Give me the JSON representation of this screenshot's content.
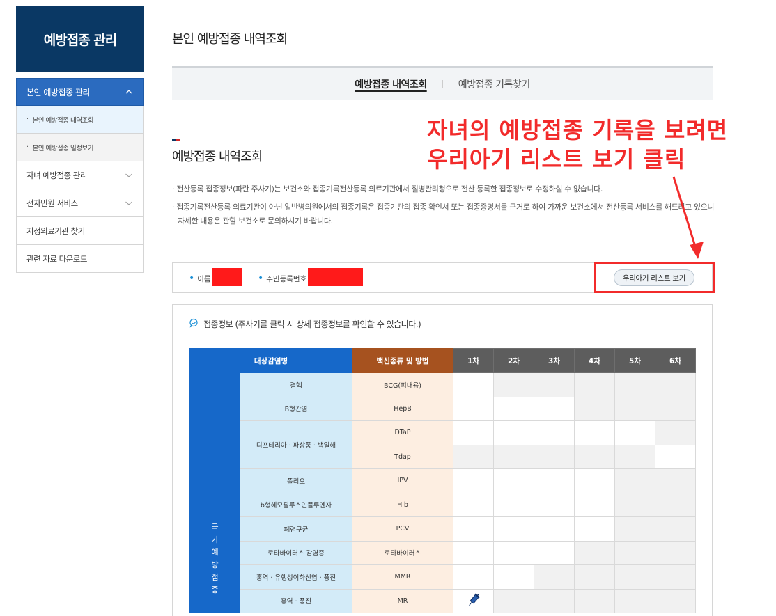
{
  "sidebar": {
    "title": "예방접종 관리",
    "section": "본인 예방접종 관리",
    "sub_items": [
      "본인 예방접종 내역조회",
      "본인 예방접종 일정보기"
    ],
    "items": [
      "자녀 예방접종 관리",
      "전자민원 서비스",
      "지정의료기관 찾기",
      "관련 자료 다운로드"
    ]
  },
  "page": {
    "title": "본인 예방접종 내역조회",
    "tabs": [
      "예방접종 내역조회",
      "예방접종 기록찾기"
    ],
    "section_title": "예방접종 내역조회",
    "notices": [
      "· 전산등록 접종정보(파란 주사기)는 보건소와 접종기록전산등록 의료기관에서 질병관리청으로 전산 등록한 접종정보로 수정하실 수 없습니다.",
      "· 접종기록전산등록 의료기관이 아닌 일반병의원에서의 접종기록은 접종기관의 접종 확인서 또는 접종증명서를 근거로 하여 가까운 보건소에서 전산등록 서비스를 해드리고 있으니 자세한 내용은 관할 보건소로 문의하시기 바랍니다."
    ]
  },
  "annotation": {
    "line1": "자녀의 예방접종 기록을 보려면",
    "line2": "우리아기 리스트 보기 클릭",
    "color": "#f22b2b"
  },
  "info": {
    "name_label": "이름 :",
    "id_label": "주민등록번호 :",
    "list_button": "우리아기 리스트 보기"
  },
  "panel_title": "접종정보 (주사기를 클릭 시 상세 접종정보를 확인할 수 있습니다.)",
  "table": {
    "headers": [
      "대상감염병",
      "백신종류 및 방법",
      "1차",
      "2차",
      "3차",
      "4차",
      "5차",
      "6차"
    ],
    "category": [
      "국",
      "가",
      "예",
      "방",
      "접",
      "종"
    ],
    "rows": [
      {
        "disease": "결핵",
        "vaccine": "BCG(피내용)"
      },
      {
        "disease": "B형간염",
        "vaccine": "HepB"
      },
      {
        "disease": "디프테리아 · 파상풍 · 백일해",
        "vaccine": "DTaP"
      },
      {
        "disease": "",
        "vaccine": "Tdap"
      },
      {
        "disease": "폴리오",
        "vaccine": "IPV"
      },
      {
        "disease": "b형헤모필루스인플루엔자",
        "vaccine": "Hib"
      },
      {
        "disease": "폐렴구균",
        "vaccine": "PCV"
      },
      {
        "disease": "로타바이러스 감염증",
        "vaccine": "로타바이러스"
      },
      {
        "disease": "홍역 · 유행성이하선염 · 풍진",
        "vaccine": "MMR"
      },
      {
        "disease": "홍역 · 풍진",
        "vaccine": "MR"
      }
    ]
  }
}
